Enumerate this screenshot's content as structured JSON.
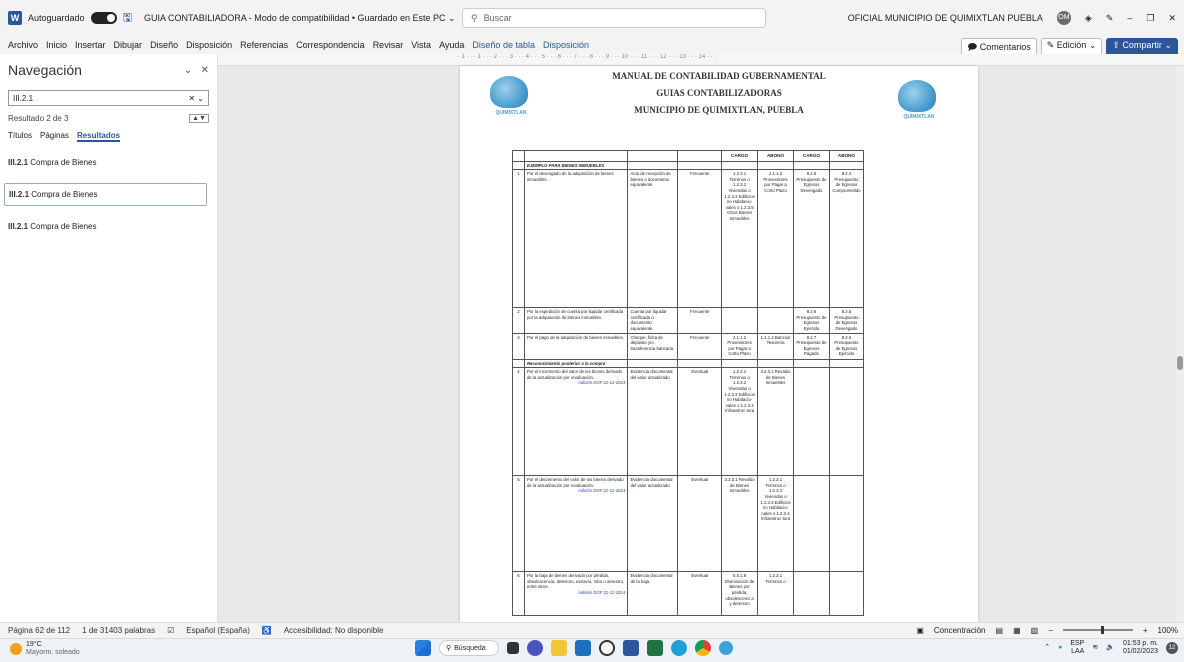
{
  "titlebar": {
    "autosave_label": "Autoguardado",
    "doc_title": "GUIA CONTABILIADORA - Modo de compatibilidad • Guardado en Este PC ⌄",
    "search_placeholder": "Buscar",
    "user_name": "OFICIAL MUNICIPIO DE QUIMIXTLAN PUEBLA",
    "user_initials": "OM",
    "minimize": "–",
    "restore": "❐",
    "close": "✕"
  },
  "menu": {
    "items": [
      "Archivo",
      "Inicio",
      "Insertar",
      "Dibujar",
      "Diseño",
      "Disposición",
      "Referencias",
      "Correspondencia",
      "Revisar",
      "Vista",
      "Ayuda"
    ],
    "context_items": [
      "Diseño de tabla",
      "Disposición"
    ],
    "comments": "Comentarios",
    "editing": "Edición",
    "share": "Compartir"
  },
  "navigation": {
    "title": "Navegación",
    "search_value": "III.2.1",
    "result_count": "Resultado 2 de 3",
    "tabs": [
      "Títulos",
      "Páginas",
      "Resultados"
    ],
    "results": [
      {
        "code": "III.2.1",
        "text": "Compra de Bienes"
      },
      {
        "code": "III.2.1",
        "text": "Compra de Bienes"
      },
      {
        "code": "III.2.1",
        "text": "Compra de Bienes"
      }
    ]
  },
  "document": {
    "header_lines": [
      "MANUAL DE CONTABILIDAD GUBERNAMENTAL",
      "GUIAS CONTABILIZADORAS",
      "MUNICIPIO DE QUIMIXTLAN, PUEBLA"
    ],
    "logo_text": "QUIMIXTLAN",
    "table_headers": [
      "CARGO",
      "ABONO",
      "CARGO",
      "ABONO"
    ],
    "section_1": "EJEMPLO PARA BIENES INMUEBLES",
    "section_2": "Reconocimiento posterior a la compra",
    "dof": "Adición DOF 22-12-2014",
    "rows": [
      {
        "n": "1",
        "desc": "Por el devengado de la adquisición de bienes inmuebles.",
        "doc": "Acta de recepción de bienes o documento equivalente.",
        "freq": "Frecuente",
        "c1": "1.2.3.1 Terrenos o 1.2.3.2 Viviendas o 1.2.3.3 Edificios no Habitacio-nales o 1.2.3.5 Otros Bienes Inmuebles",
        "a1": "2.1.1.2 Proveedores por Pagar a Corto Plazo",
        "c2": "8.2.5 Presupuesto de Egresos Devengado",
        "a2": "8.2.4 Presupuesto de Egresos Comprometido"
      },
      {
        "n": "2",
        "desc": "Por la expedición de cuenta por liquidar certificada por la adquisición de bienes inmuebles.",
        "doc": "Cuenta por liquidar certificada o documento equivalente.",
        "freq": "Frecuente",
        "c1": "",
        "a1": "",
        "c2": "8.2.6 Presupuesto de Egresos Ejercido",
        "a2": "8.2.5 Presupuesto de Egresos Devengado"
      },
      {
        "n": "3",
        "desc": "Por el pago de la adquisición de bienes inmuebles.",
        "doc": "Cheque, ficha de depósito y/o transferencia bancaria.",
        "freq": "Frecuente",
        "c1": "2.1.1.2 Proveedores por Pagar a Corto Plazo",
        "a1": "1.1.1.2 Bancos/ Tesorería",
        "c2": "8.2.7 Presupuesto de Egresos Pagado",
        "a2": "8.2.6 Presupuesto de Egresos Ejercido"
      },
      {
        "n": "4",
        "desc": "Por el incremento del valor de los bienes derivado de la actualización por revaluación.",
        "doc": "Evidencia documental del valor actualizado",
        "freq": "Eventual",
        "c1": "1.2.3.1 Terrenos o 1.2.3.2 Viviendas o 1.2.3.3 Edificios no Habitacio-nales o 1.2.3.4 Infraestruc-tura",
        "a1": "3.2.3.1 Revalúo de Bienes Inmuebles",
        "c2": "",
        "a2": ""
      },
      {
        "n": "5",
        "desc": "Por el decremento del valor de los bienes derivado de la actualización por revaluación.",
        "doc": "Evidencia documental del valor actualizado",
        "freq": "Eventual",
        "c1": "3.2.3.1 Revalúo de Bienes Inmuebles",
        "a1": "1.2.3.1 Terrenos o 1.2.3.2 Viviendas o 1.2.3.3 Edificios no Habitacio-nales o 1.2.3.4 Infraestruc-tura",
        "c2": "",
        "a2": ""
      },
      {
        "n": "6",
        "desc": "Por la baja de bienes derivado por pérdida, obsolescencia, deterioro, extravío, robo o siniestro, entre otros.",
        "doc": "Evidencia documental de la baja.",
        "freq": "Eventual",
        "c1": "5.5.1.8 Disminución de Bienes por pérdida, obsolescenci a y deterioro",
        "a1": "1.2.3.1 Terrenos o",
        "c2": "",
        "a2": ""
      }
    ]
  },
  "status": {
    "page": "Página 62 de 112",
    "words": "1 de 31403 palabras",
    "language": "Español (España)",
    "accessibility": "Accesibilidad: No disponible",
    "focus": "Concentración",
    "zoom": "100%"
  },
  "taskbar": {
    "temp": "19°C",
    "weather": "Mayorm. soleado",
    "search": "Búsqueda",
    "lang1": "ESP",
    "lang2": "LAA",
    "time": "01:53 p. m.",
    "date": "01/02/2023",
    "notif": "12"
  }
}
